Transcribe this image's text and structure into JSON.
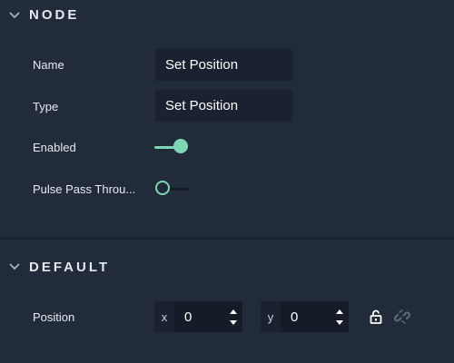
{
  "sections": {
    "node": {
      "title": "NODE",
      "fields": {
        "name": {
          "label": "Name",
          "value": "Set Position"
        },
        "type": {
          "label": "Type",
          "value": "Set Position"
        },
        "enabled": {
          "label": "Enabled",
          "state": true
        },
        "pulse": {
          "label": "Pulse Pass Throu...",
          "state": false
        }
      }
    },
    "default": {
      "title": "DEFAULT",
      "position": {
        "label": "Position",
        "x": {
          "axis": "x",
          "value": "0"
        },
        "y": {
          "axis": "y",
          "value": "0"
        }
      }
    }
  },
  "icons": [
    "chevron-down-icon",
    "lock-icon",
    "link-icon",
    "stepper-up-icon",
    "stepper-down-icon"
  ],
  "colors": {
    "background": "#212b3a",
    "field": "#1a2231",
    "accent": "#7fd6b4"
  }
}
